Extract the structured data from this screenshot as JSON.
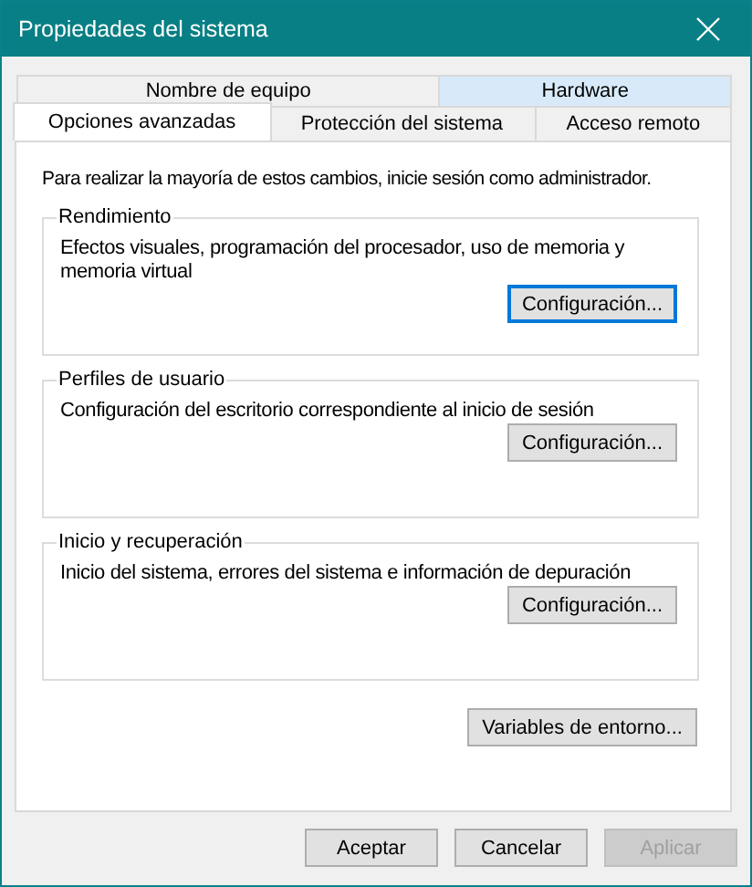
{
  "window": {
    "title": "Propiedades del sistema"
  },
  "tab_rows": [
    [
      {
        "label": "Nombre de equipo",
        "selected": false,
        "hovered": false
      },
      {
        "label": "Hardware",
        "selected": false,
        "hovered": true
      }
    ],
    [
      {
        "label": "Opciones avanzadas",
        "selected": true,
        "hovered": false
      },
      {
        "label": "Protección del sistema",
        "selected": false,
        "hovered": false
      },
      {
        "label": "Acceso remoto",
        "selected": false,
        "hovered": false
      }
    ]
  ],
  "intro": "Para realizar la mayoría de estos cambios, inicie sesión como administrador.",
  "groups": [
    {
      "title": "Rendimiento",
      "description": "Efectos visuales, programación del procesador, uso de memoria y memoria virtual",
      "button": {
        "label": "Configuración...",
        "focused": true
      }
    },
    {
      "title": "Perfiles de usuario",
      "description": "Configuración del escritorio correspondiente al inicio de sesión",
      "button": {
        "label": "Configuración...",
        "focused": false
      }
    },
    {
      "title": "Inicio y recuperación",
      "description": "Inicio del sistema, errores del sistema e información de depuración",
      "button": {
        "label": "Configuración...",
        "focused": false
      }
    }
  ],
  "environment_button": {
    "label": "Variables de entorno..."
  },
  "dialog_buttons": [
    {
      "label": "Aceptar",
      "disabled": false
    },
    {
      "label": "Cancelar",
      "disabled": false
    },
    {
      "label": "Aplicar",
      "disabled": true
    }
  ]
}
